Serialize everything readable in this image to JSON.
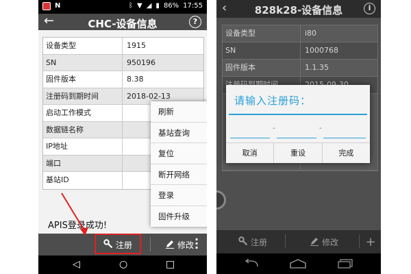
{
  "left": {
    "status_bar": {
      "battery": "86%",
      "time": "17:55"
    },
    "header": {
      "title": "CHC-设备信息",
      "help": "?"
    },
    "rows": [
      {
        "key": "设备类型",
        "value": "1915"
      },
      {
        "key": "SN",
        "value": "950196"
      },
      {
        "key": "固件版本",
        "value": "8.38"
      },
      {
        "key": "注册码到期时间",
        "value": "2018-02-13"
      },
      {
        "key": "启动工作模式",
        "value": ""
      },
      {
        "key": "数据链名称",
        "value": ""
      },
      {
        "key": "IP地址",
        "value": ""
      },
      {
        "key": "端口",
        "value": ""
      },
      {
        "key": "基站ID",
        "value": ""
      }
    ],
    "menu": [
      "刷新",
      "基站查询",
      "复位",
      "断开网络",
      "登录",
      "固件升级"
    ],
    "toast": "APIS登录成功!",
    "bottom": {
      "register": "注册",
      "modify": "修改"
    }
  },
  "right": {
    "header": {
      "title": "828k28-设备信息",
      "info": "i"
    },
    "rows": [
      {
        "key": "设备类型",
        "value": "i80"
      },
      {
        "key": "SN",
        "value": "1000768"
      },
      {
        "key": "固件版本",
        "value": "1.1.35"
      },
      {
        "key": "注册码到期时间",
        "value": "2015-09-30"
      }
    ],
    "dialog": {
      "title": "请输入注册码：",
      "buttons": [
        "取消",
        "重设",
        "完成"
      ]
    },
    "bottom": {
      "register": "注册",
      "modify": "修改",
      "plus": "+"
    }
  },
  "colors": {
    "accent_blue": "#2aa0d6",
    "highlight_red": "#e02020"
  }
}
